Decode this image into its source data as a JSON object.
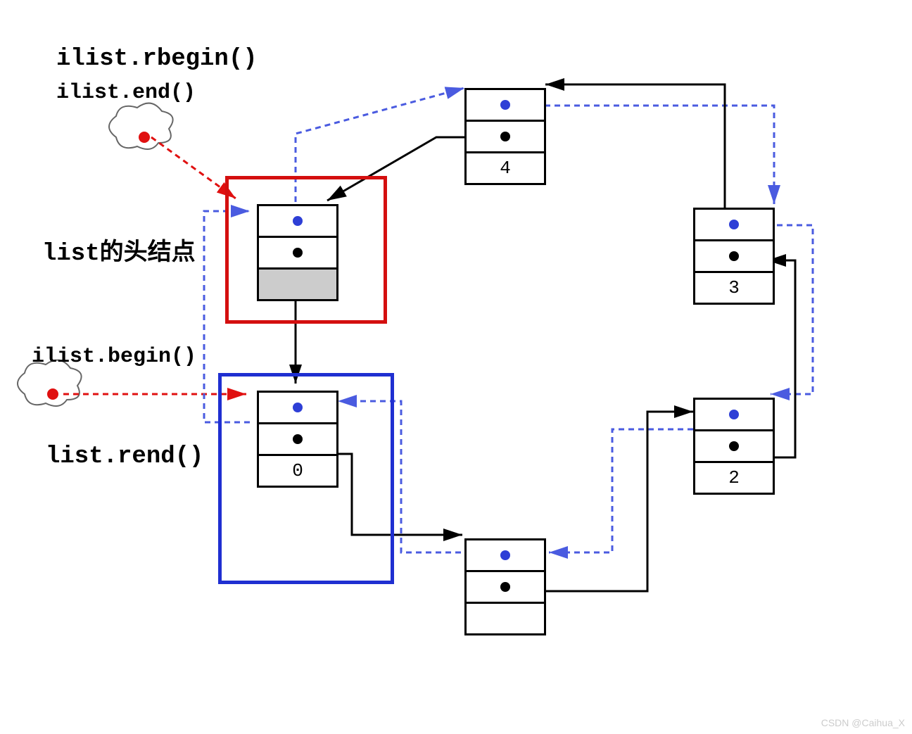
{
  "labels": {
    "rbegin": "ilist.rbegin()",
    "end": "ilist.end()",
    "head": "list的头结点",
    "begin": "ilist.begin()",
    "rend": "list.rend()"
  },
  "nodes": {
    "head": "",
    "n0": "0",
    "n1": "",
    "n2": "2",
    "n3": "3",
    "n4": "4"
  },
  "highlights": {
    "red": "#d40f0f",
    "blue": "#1f2fd1"
  },
  "colors": {
    "prev_arrow": "#4a5be0",
    "next_arrow": "#000",
    "ptr_arrow": "#e01010",
    "ptr_dot": "#e01010"
  },
  "watermark": "CSDN @Caihua_X"
}
